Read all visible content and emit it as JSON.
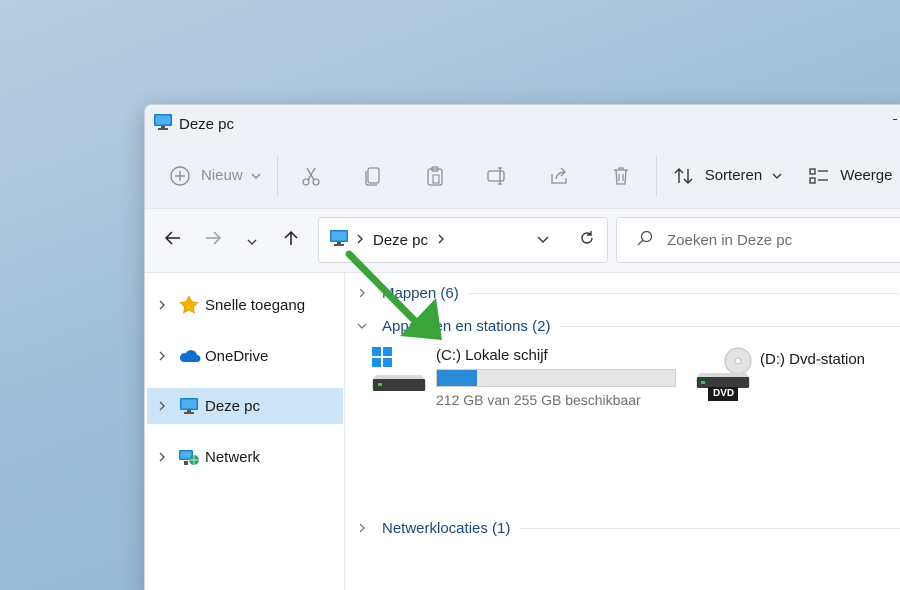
{
  "window": {
    "title": "Deze pc"
  },
  "toolbar": {
    "new_label": "Nieuw",
    "sort_label": "Sorteren",
    "view_label": "Weerge"
  },
  "address": {
    "crumb": "Deze pc",
    "search_placeholder": "Zoeken in Deze pc"
  },
  "sidebar": {
    "items": [
      {
        "label": "Snelle toegang"
      },
      {
        "label": "OneDrive"
      },
      {
        "label": "Deze pc"
      },
      {
        "label": "Netwerk"
      }
    ]
  },
  "main": {
    "groups": [
      {
        "label": "Mappen (6)"
      },
      {
        "label": "Apparaten en stations (2)"
      },
      {
        "label": "Netwerklocaties (1)"
      }
    ],
    "drives": [
      {
        "name": "(C:) Lokale schijf",
        "free": "212 GB van 255 GB beschikbaar",
        "used_fraction": 0.169
      },
      {
        "name": "(D:) Dvd-station",
        "badge": "DVD"
      }
    ]
  },
  "colors": {
    "accent": "#2b8ad8",
    "selection": "#cce4f7",
    "arrow": "#3aa33a"
  }
}
